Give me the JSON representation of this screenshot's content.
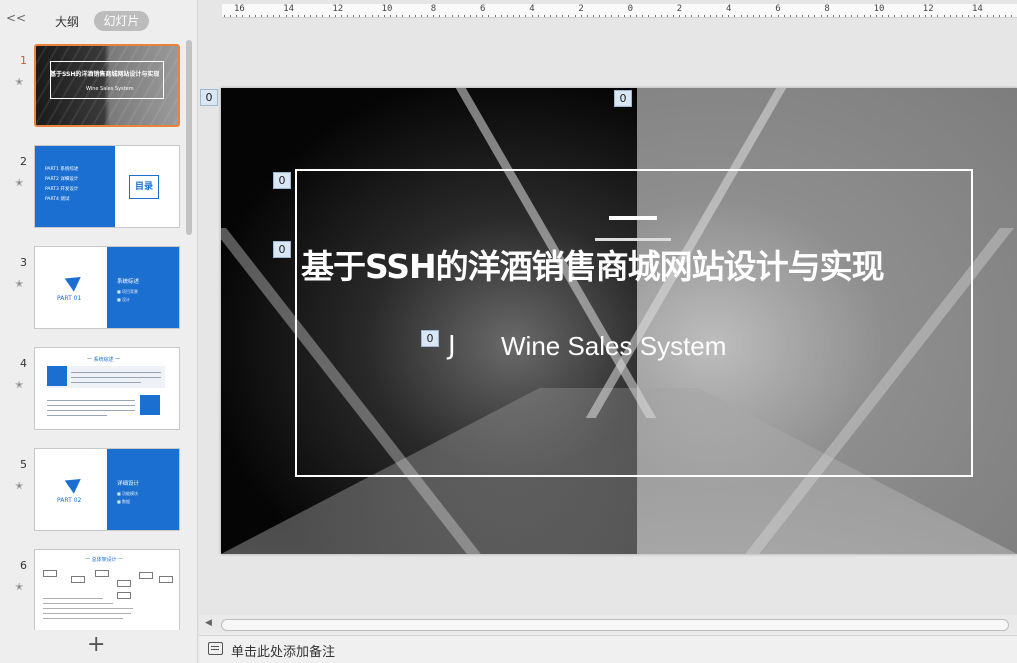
{
  "left_panel": {
    "collapse_glyph": "<<",
    "tab_outline": "大纲",
    "tab_slides": "幻灯片",
    "add_glyph": "+",
    "slides": [
      {
        "num": "1",
        "title_line": "基于SSH的洋酒销售商城网站设计与实现",
        "sub": "Wine Sales System"
      },
      {
        "num": "2",
        "items": [
          "PART1 系统综述",
          "PART2 详细设计",
          "PART3 开发设计",
          "PART4 测试"
        ],
        "box": "目录"
      },
      {
        "num": "3",
        "part": "PART 01",
        "title": "系统综述",
        "lines": [
          "■ 项目背景",
          "■ 设计"
        ]
      },
      {
        "num": "4",
        "header": "一 系统综述 一"
      },
      {
        "num": "5",
        "part": "PART 02",
        "title": "详细设计",
        "lines": [
          "■ 功能模块",
          "■ 数据"
        ]
      },
      {
        "num": "6",
        "header": "一   总体架设计   一"
      }
    ]
  },
  "ruler": {
    "labels": [
      "16",
      "14",
      "12",
      "10",
      "8",
      "6",
      "4",
      "2",
      "0",
      "2",
      "4",
      "6",
      "8",
      "10",
      "12",
      "14"
    ]
  },
  "slide": {
    "title": "基于SSH的洋酒销售商城网站设计与实现",
    "subtitle_prefix": "J",
    "subtitle": "Wine Sales System",
    "tags": [
      "0",
      "0",
      "0",
      "0",
      "0"
    ]
  },
  "notes": {
    "placeholder": "单击此处添加备注"
  }
}
